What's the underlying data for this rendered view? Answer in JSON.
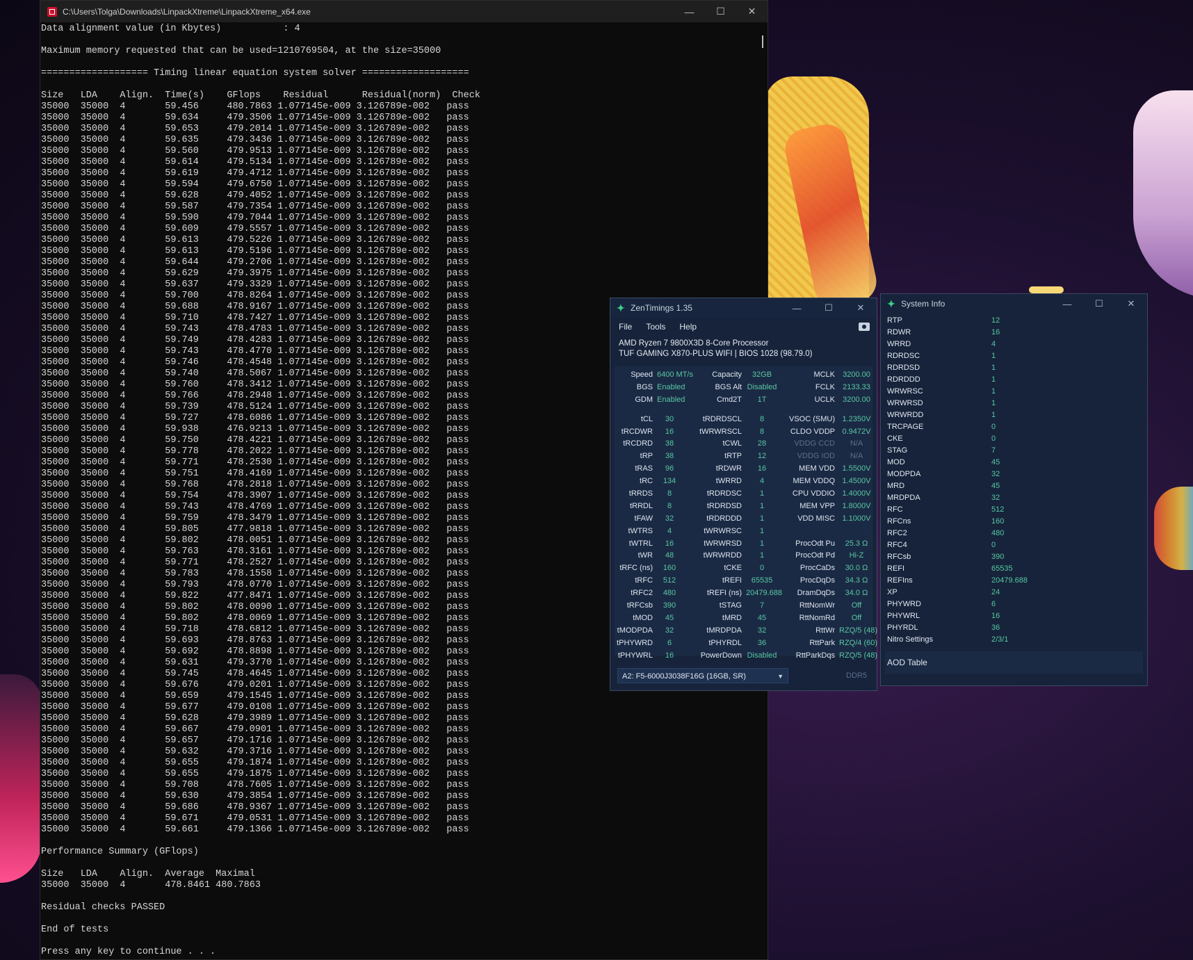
{
  "console": {
    "title": "C:\\Users\\Tolga\\Downloads\\LinpackXtreme\\LinpackXtreme_x64.exe",
    "pre_lines": [
      "Data alignment value (in Kbytes)           : 4",
      "",
      "Maximum memory requested that can be used=1210769504, at the size=35000",
      "",
      "=================== Timing linear equation system solver ===================",
      ""
    ],
    "header": "Size   LDA    Align.  Time(s)    GFlops    Residual      Residual(norm)  Check",
    "row_const": {
      "size": "35000",
      "lda": "35000",
      "align": "4",
      "residual": "1.077145e-009",
      "residual_norm": "3.126789e-002",
      "check": "pass"
    },
    "rows": [
      [
        "59.456",
        "480.7863"
      ],
      [
        "59.634",
        "479.3506"
      ],
      [
        "59.653",
        "479.2014"
      ],
      [
        "59.635",
        "479.3436"
      ],
      [
        "59.560",
        "479.9513"
      ],
      [
        "59.614",
        "479.5134"
      ],
      [
        "59.619",
        "479.4712"
      ],
      [
        "59.594",
        "479.6750"
      ],
      [
        "59.628",
        "479.4052"
      ],
      [
        "59.587",
        "479.7354"
      ],
      [
        "59.590",
        "479.7044"
      ],
      [
        "59.609",
        "479.5557"
      ],
      [
        "59.613",
        "479.5226"
      ],
      [
        "59.613",
        "479.5196"
      ],
      [
        "59.644",
        "479.2706"
      ],
      [
        "59.629",
        "479.3975"
      ],
      [
        "59.637",
        "479.3329"
      ],
      [
        "59.700",
        "478.8264"
      ],
      [
        "59.688",
        "478.9167"
      ],
      [
        "59.710",
        "478.7427"
      ],
      [
        "59.743",
        "478.4783"
      ],
      [
        "59.749",
        "478.4283"
      ],
      [
        "59.743",
        "478.4770"
      ],
      [
        "59.746",
        "478.4548"
      ],
      [
        "59.740",
        "478.5067"
      ],
      [
        "59.760",
        "478.3412"
      ],
      [
        "59.766",
        "478.2948"
      ],
      [
        "59.739",
        "478.5124"
      ],
      [
        "59.727",
        "478.6086"
      ],
      [
        "59.938",
        "476.9213"
      ],
      [
        "59.750",
        "478.4221"
      ],
      [
        "59.778",
        "478.2022"
      ],
      [
        "59.771",
        "478.2530"
      ],
      [
        "59.751",
        "478.4169"
      ],
      [
        "59.768",
        "478.2818"
      ],
      [
        "59.754",
        "478.3907"
      ],
      [
        "59.743",
        "478.4769"
      ],
      [
        "59.759",
        "478.3479"
      ],
      [
        "59.805",
        "477.9818"
      ],
      [
        "59.802",
        "478.0051"
      ],
      [
        "59.763",
        "478.3161"
      ],
      [
        "59.771",
        "478.2527"
      ],
      [
        "59.783",
        "478.1558"
      ],
      [
        "59.793",
        "478.0770"
      ],
      [
        "59.822",
        "477.8471"
      ],
      [
        "59.802",
        "478.0090"
      ],
      [
        "59.802",
        "478.0069"
      ],
      [
        "59.718",
        "478.6812"
      ],
      [
        "59.693",
        "478.8763"
      ],
      [
        "59.692",
        "478.8898"
      ],
      [
        "59.631",
        "479.3770"
      ],
      [
        "59.745",
        "478.4645"
      ],
      [
        "59.676",
        "479.0201"
      ],
      [
        "59.659",
        "479.1545"
      ],
      [
        "59.677",
        "479.0108"
      ],
      [
        "59.628",
        "479.3989"
      ],
      [
        "59.667",
        "479.0901"
      ],
      [
        "59.657",
        "479.1716"
      ],
      [
        "59.632",
        "479.3716"
      ],
      [
        "59.655",
        "479.1874"
      ],
      [
        "59.655",
        "479.1875"
      ],
      [
        "59.708",
        "478.7605"
      ],
      [
        "59.630",
        "479.3854"
      ],
      [
        "59.686",
        "478.9367"
      ],
      [
        "59.671",
        "479.0531"
      ],
      [
        "59.661",
        "479.1366"
      ]
    ],
    "post_lines": [
      "",
      "Performance Summary (GFlops)",
      "",
      "Size   LDA    Align.  Average  Maximal",
      "35000  35000  4       478.8461 480.7863",
      "",
      "Residual checks PASSED",
      "",
      "End of tests",
      "",
      "Press any key to continue . . ."
    ]
  },
  "zen": {
    "title": "ZenTimings 1.35",
    "menu": [
      "File",
      "Tools",
      "Help"
    ],
    "cpu": "AMD Ryzen 7 9800X3D 8-Core Processor",
    "board": "TUF GAMING X870-PLUS WIFI | BIOS 1028 (98.79.0)",
    "top": [
      [
        "Speed",
        "6400 MT/s",
        "Capacity",
        "32GB",
        "MCLK",
        "3200.00"
      ],
      [
        "BGS",
        "Enabled",
        "BGS Alt",
        "Disabled",
        "FCLK",
        "2133.33"
      ],
      [
        "GDM",
        "Enabled",
        "Cmd2T",
        "1T",
        "UCLK",
        "3200.00"
      ]
    ],
    "grid": [
      [
        "tCL",
        "30",
        "tRDRDSCL",
        "8",
        "VSOC (SMU)",
        "1.2350V"
      ],
      [
        "tRCDWR",
        "16",
        "tWRWRSCL",
        "8",
        "CLDO VDDP",
        "0.9472V"
      ],
      [
        "tRCDRD",
        "38",
        "tCWL",
        "28",
        "VDDG CCD",
        "N/A"
      ],
      [
        "tRP",
        "38",
        "tRTP",
        "12",
        "VDDG IOD",
        "N/A"
      ],
      [
        "tRAS",
        "96",
        "tRDWR",
        "16",
        "MEM VDD",
        "1.5500V"
      ],
      [
        "tRC",
        "134",
        "tWRRD",
        "4",
        "MEM VDDQ",
        "1.4500V"
      ],
      [
        "tRRDS",
        "8",
        "tRDRDSC",
        "1",
        "CPU VDDIO",
        "1.4000V"
      ],
      [
        "tRRDL",
        "8",
        "tRDRDSD",
        "1",
        "MEM VPP",
        "1.8000V"
      ],
      [
        "tFAW",
        "32",
        "tRDRDDD",
        "1",
        "VDD MISC",
        "1.1000V"
      ],
      [
        "tWTRS",
        "4",
        "tWRWRSC",
        "1",
        "",
        ""
      ],
      [
        "tWTRL",
        "16",
        "tWRWRSD",
        "1",
        "ProcOdt Pu",
        "25.3 Ω"
      ],
      [
        "tWR",
        "48",
        "tWRWRDD",
        "1",
        "ProcOdt Pd",
        "Hi-Z"
      ],
      [
        "tRFC (ns)",
        "160",
        "tCKE",
        "0",
        "ProcCaDs",
        "30.0 Ω"
      ],
      [
        "tRFC",
        "512",
        "tREFI",
        "65535",
        "ProcDqDs",
        "34.3 Ω"
      ],
      [
        "tRFC2",
        "480",
        "tREFI (ns)",
        "20479.688",
        "DramDqDs",
        "34.0 Ω"
      ],
      [
        "tRFCsb",
        "390",
        "tSTAG",
        "7",
        "RttNomWr",
        "Off"
      ],
      [
        "tMOD",
        "45",
        "tMRD",
        "45",
        "RttNomRd",
        "Off"
      ],
      [
        "tMODPDA",
        "32",
        "tMRDPDA",
        "32",
        "RttWr",
        "RZQ/5 (48)"
      ],
      [
        "tPHYWRD",
        "6",
        "tPHYRDL",
        "36",
        "RttPark",
        "RZQ/4 (60)"
      ],
      [
        "tPHYWRL",
        "16",
        "PowerDown",
        "Disabled",
        "RttParkDqs",
        "RZQ/5 (48)"
      ]
    ],
    "dimm": "A2: F5-6000J3038F16G (16GB, SR)",
    "ddr": "DDR5"
  },
  "sysinfo": {
    "title": "System Info",
    "items": [
      [
        "RTP",
        "12"
      ],
      [
        "RDWR",
        "16"
      ],
      [
        "WRRD",
        "4"
      ],
      [
        "RDRDSC",
        "1"
      ],
      [
        "RDRDSD",
        "1"
      ],
      [
        "RDRDDD",
        "1"
      ],
      [
        "WRWRSC",
        "1"
      ],
      [
        "WRWRSD",
        "1"
      ],
      [
        "WRWRDD",
        "1"
      ],
      [
        "TRCPAGE",
        "0"
      ],
      [
        "CKE",
        "0"
      ],
      [
        "STAG",
        "7"
      ],
      [
        "MOD",
        "45"
      ],
      [
        "MODPDA",
        "32"
      ],
      [
        "MRD",
        "45"
      ],
      [
        "MRDPDA",
        "32"
      ],
      [
        "RFC",
        "512"
      ],
      [
        "RFCns",
        "160"
      ],
      [
        "RFC2",
        "480"
      ],
      [
        "RFC4",
        "0"
      ],
      [
        "RFCsb",
        "390"
      ],
      [
        "REFI",
        "65535"
      ],
      [
        "REFIns",
        "20479.688"
      ],
      [
        "XP",
        "24"
      ],
      [
        "PHYWRD",
        "6"
      ],
      [
        "PHYWRL",
        "16"
      ],
      [
        "PHYRDL",
        "36"
      ],
      [
        "Nitro Settings",
        "2/3/1"
      ]
    ],
    "aod": "AOD Table"
  },
  "window_controls": {
    "minimize": "—",
    "maximize": "☐",
    "close": "✕"
  }
}
